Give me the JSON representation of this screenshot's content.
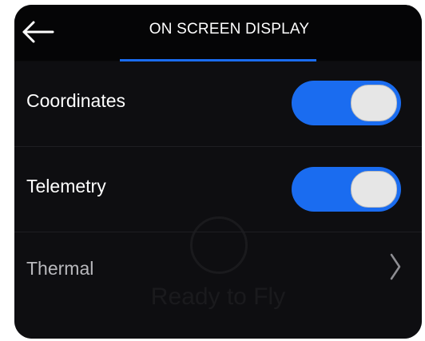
{
  "header": {
    "title": "ON SCREEN DISPLAY",
    "back_icon": "arrow-left-icon"
  },
  "settings": [
    {
      "label": "Coordinates",
      "type": "toggle",
      "enabled": true
    },
    {
      "label": "Telemetry",
      "type": "toggle",
      "enabled": true
    },
    {
      "label": "Thermal",
      "type": "link",
      "icon": "chevron-right-icon"
    }
  ],
  "watermark": {
    "text": "Ready to Fly",
    "icon": "check-circle-icon"
  },
  "colors": {
    "accent": "#1a6cf0",
    "background": "#0e0e11",
    "header_background": "#050506",
    "text": "#ffffff",
    "muted_text": "#b9b9bd"
  }
}
